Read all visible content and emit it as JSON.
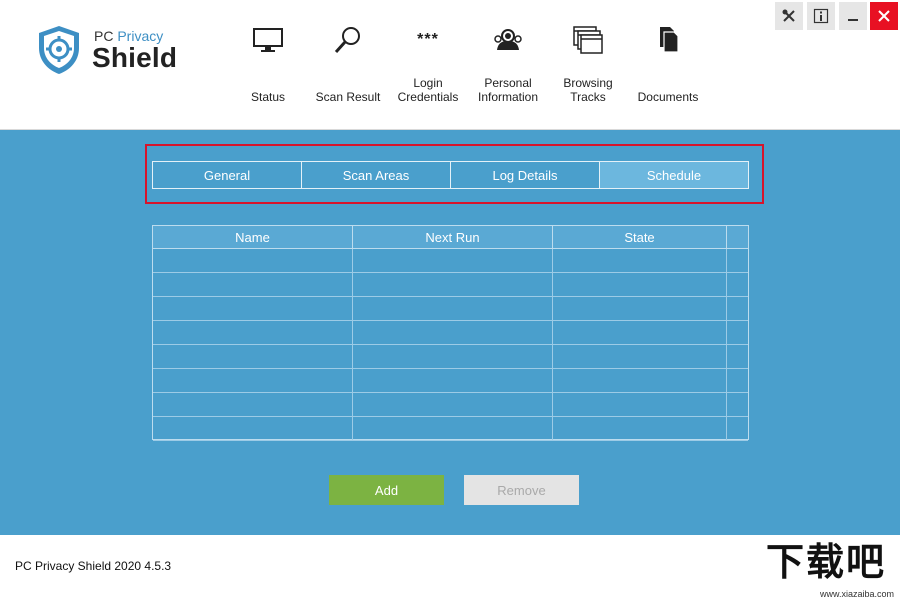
{
  "app": {
    "logo_small_pc": "PC",
    "logo_small_privacy": "Privacy",
    "logo_big": "Shield"
  },
  "nav": [
    {
      "label": "Status",
      "icon": "monitor-icon"
    },
    {
      "label": "Scan Result",
      "icon": "magnifier-icon"
    },
    {
      "label": "Login\nCredentials",
      "icon": "password-icon"
    },
    {
      "label": "Personal\nInformation",
      "icon": "person-icon"
    },
    {
      "label": "Browsing\nTracks",
      "icon": "browser-windows-icon"
    },
    {
      "label": "Documents",
      "icon": "documents-icon"
    }
  ],
  "window_controls": {
    "tools_icon": "tools-icon",
    "info_icon": "info-icon",
    "minimize_icon": "minimize-icon",
    "close_icon": "close-icon"
  },
  "tabs": [
    {
      "label": "General",
      "active": false
    },
    {
      "label": "Scan Areas",
      "active": false
    },
    {
      "label": "Log Details",
      "active": false
    },
    {
      "label": "Schedule",
      "active": true
    }
  ],
  "grid": {
    "columns": [
      "Name",
      "Next Run",
      "State"
    ],
    "rows": [
      [
        "",
        "",
        ""
      ],
      [
        "",
        "",
        ""
      ],
      [
        "",
        "",
        ""
      ],
      [
        "",
        "",
        ""
      ],
      [
        "",
        "",
        ""
      ],
      [
        "",
        "",
        ""
      ],
      [
        "",
        "",
        ""
      ],
      [
        "",
        "",
        ""
      ]
    ]
  },
  "actions": {
    "add_label": "Add",
    "remove_label": "Remove"
  },
  "footer": {
    "version": "PC Privacy Shield 2020 4.5.3"
  },
  "watermark": {
    "chinese": "下载吧",
    "url": "www.xiazaiba.com"
  },
  "colors": {
    "main_bg": "#4a9fcc",
    "active_tab": "#6cb7de",
    "add_button": "#7cb342",
    "highlight_border": "#d7142b",
    "close_button": "#e81123"
  }
}
